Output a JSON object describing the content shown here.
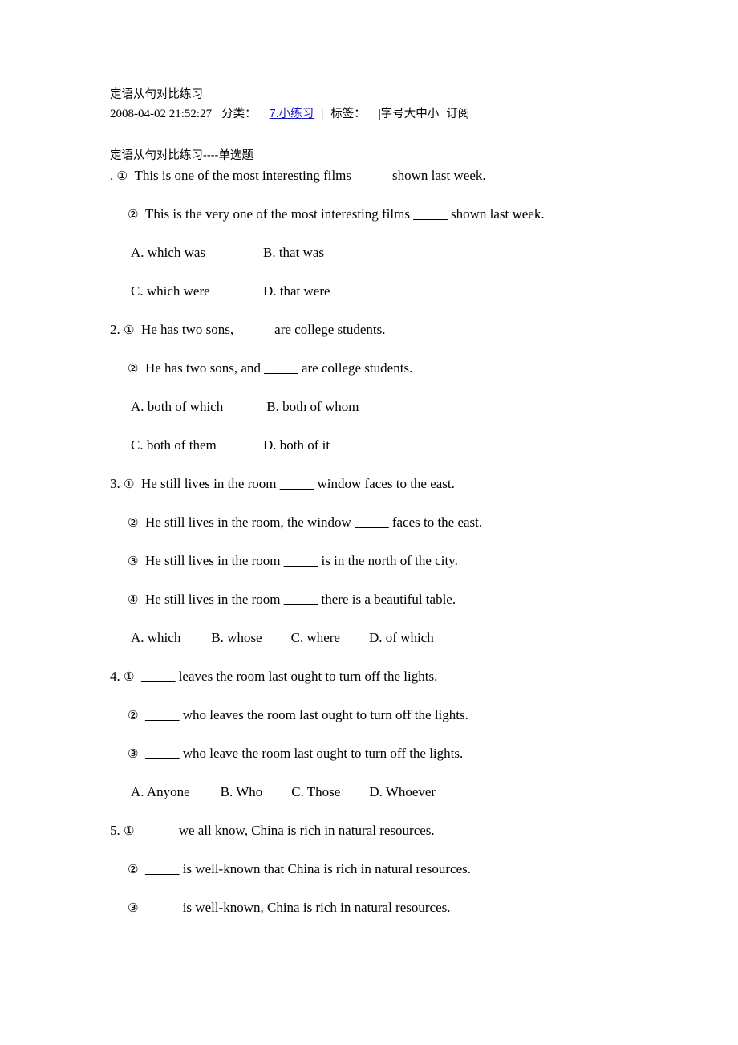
{
  "post": {
    "title": "定语从句对比练习",
    "timestamp": "2008-04-02 21:52:27",
    "bar1": "|",
    "category_label": "分类：",
    "category_link": "7.小练习",
    "sep": "|",
    "tag_label": "标签：",
    "bar2": "|",
    "fontsize_controls": "字号大中小",
    "subscribe": "订阅",
    "link_color": "#1414cc"
  },
  "body": {
    "heading": "定语从句对比练习----单选题",
    "questions": [
      {
        "number": ".",
        "items": [
          {
            "marker": "①",
            "text": "This is one of the most interesting films ",
            "blank": "_____",
            "text_after": " shown last week."
          },
          {
            "marker": "②",
            "text": "This is the very one of the most interesting films ",
            "blank": "_____",
            "text_after": " shown last week."
          }
        ],
        "option_rows": [
          [
            "A. which was",
            "B. that was"
          ],
          [
            "C. which were",
            "D. that were"
          ]
        ]
      },
      {
        "number": "2.",
        "items": [
          {
            "marker": "①",
            "text": "He has two sons, ",
            "blank": "_____",
            "text_after": " are college students."
          },
          {
            "marker": "②",
            "text": "He has two sons, and ",
            "blank": "_____",
            "text_after": " are college students."
          }
        ],
        "option_rows": [
          [
            "A. both of which",
            " B. both of whom"
          ],
          [
            "C. both of them",
            "D. both of it"
          ]
        ]
      },
      {
        "number": "3.",
        "items": [
          {
            "marker": "①",
            "text": "He still lives in the room ",
            "blank": "_____",
            "text_after": " window faces to the east."
          },
          {
            "marker": "②",
            "text": "He still lives in the room, the window ",
            "blank": "_____",
            "text_after": " faces to the east."
          },
          {
            "marker": "③",
            "text": "He still lives in the room ",
            "blank": "_____",
            "text_after": " is in the north of the city."
          },
          {
            "marker": "④",
            "text": "He still lives in the room ",
            "blank": "_____",
            "text_after": " there is a beautiful table."
          }
        ],
        "option_single_row": [
          "A. which",
          "B. whose",
          "C. where",
          "D. of which"
        ]
      },
      {
        "number": "4.",
        "items": [
          {
            "marker": "①",
            "text": "",
            "blank": "_____",
            "text_after": " leaves the room last ought to turn off the lights."
          },
          {
            "marker": "②",
            "text": "",
            "blank": "_____",
            "text_after": " who leaves the room last ought to turn off the    lights."
          },
          {
            "marker": "③",
            "text": "",
            "blank": "_____",
            "text_after": " who leave the room last ought to turn off the lights."
          }
        ],
        "option_single_row": [
          "A. Anyone",
          "B. Who",
          "C. Those",
          "D. Whoever"
        ]
      },
      {
        "number": "5.",
        "items": [
          {
            "marker": "①",
            "text": "",
            "blank": "_____",
            "text_after": " we all know, China is rich in natural resources."
          },
          {
            "marker": "②",
            "text": "",
            "blank": "_____",
            "text_after": " is well-known that China is rich in natural resources."
          },
          {
            "marker": "③",
            "text": "",
            "blank": "_____",
            "text_after": " is well-known, China is rich in natural resources."
          }
        ],
        "option_single_row": []
      }
    ]
  }
}
